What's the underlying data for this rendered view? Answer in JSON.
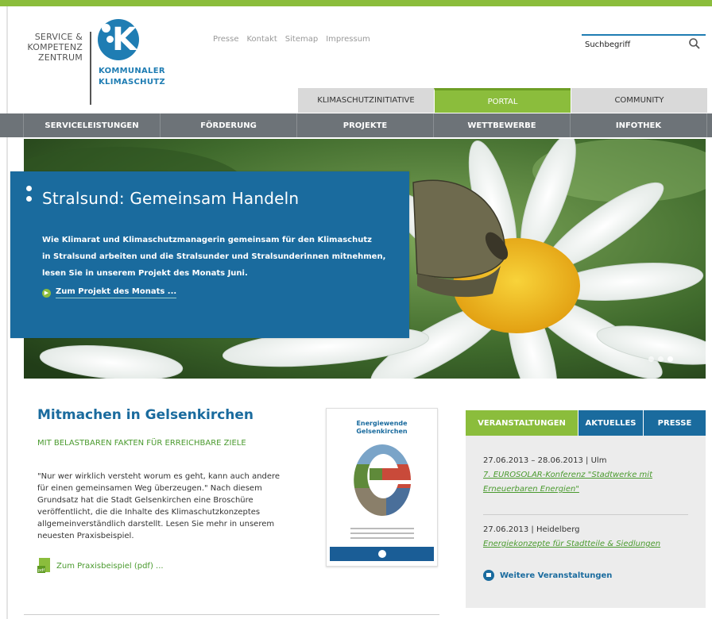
{
  "colors": {
    "green": "#8bbd3c",
    "blue": "#1a6b9e",
    "nav_gray": "#6d7378",
    "tab_gray": "#d9d9d9"
  },
  "logo": {
    "left_lines": [
      "SERVICE &",
      "KOMPETENZ",
      "ZENTRUM"
    ],
    "right_lines": [
      "KOMMUNALER",
      "KLIMASCHUTZ"
    ],
    "mark_letter": "K"
  },
  "meta_nav": [
    "Presse",
    "Kontakt",
    "Sitemap",
    "Impressum"
  ],
  "search": {
    "placeholder": "Suchbegriff",
    "icon": "search-icon"
  },
  "top_tabs": [
    {
      "label": "KLIMASCHUTZINITIATIVE",
      "active": false
    },
    {
      "label": "PORTAL",
      "active": true
    },
    {
      "label": "COMMUNITY",
      "active": false
    }
  ],
  "main_nav": [
    "SERVICELEISTUNGEN",
    "FÖRDERUNG",
    "PROJEKTE",
    "WETTBEWERBE",
    "INFOTHEK"
  ],
  "hero": {
    "title": "Stralsund: Gemeinsam Handeln",
    "text_lines": [
      "Wie Klimarat und Klimaschutzmanagerin gemeinsam für den Klimaschutz",
      "in Stralsund arbeiten und die Stralsunder und Stralsunderinnen mitnehmen,",
      "lesen Sie in unserem Projekt des Monats Juni."
    ],
    "link": "Zum Projekt des Monats ...",
    "slides": 3,
    "active_slide": 1
  },
  "article": {
    "title": "Mitmachen in Gelsenkirchen",
    "subtitle": "MIT BELASTBAREN FAKTEN FÜR ERREICHBARE ZIELE",
    "body_lines": [
      "\"Nur wer wirklich versteht worum es geht, kann auch andere",
      "für einen gemeinsamen Weg überzeugen.\" Nach diesem",
      "Grundsatz hat die Stadt Gelsenkirchen eine Broschüre",
      "veröffentlicht, die die Inhalte des Klimaschutzkonzeptes",
      "allgemeinverständlich darstellt. Lesen Sie mehr in unserem",
      "neuesten Praxisbeispiel."
    ],
    "link": "Zum Praxisbeispiel (pdf) ...",
    "brochure_title_lines": [
      "Energiewende",
      "Gelsenkirchen"
    ]
  },
  "panel": {
    "tabs": [
      {
        "label": "VERANSTALTUNGEN",
        "active": true
      },
      {
        "label": "AKTUELLES",
        "active": false
      },
      {
        "label": "PRESSE",
        "active": false
      }
    ],
    "events": [
      {
        "date": "27.06.2013 – 28.06.2013 | Ulm",
        "title_lines": [
          "7. EUROSOLAR-Konferenz \"Stadtwerke mit",
          "Erneuerbaren Energien\""
        ]
      },
      {
        "date": "27.06.2013 | Heidelberg",
        "title_lines": [
          "Energiekonzepte für Stadtteile & Siedlungen"
        ]
      }
    ],
    "more_link": "Weitere Veranstaltungen"
  }
}
